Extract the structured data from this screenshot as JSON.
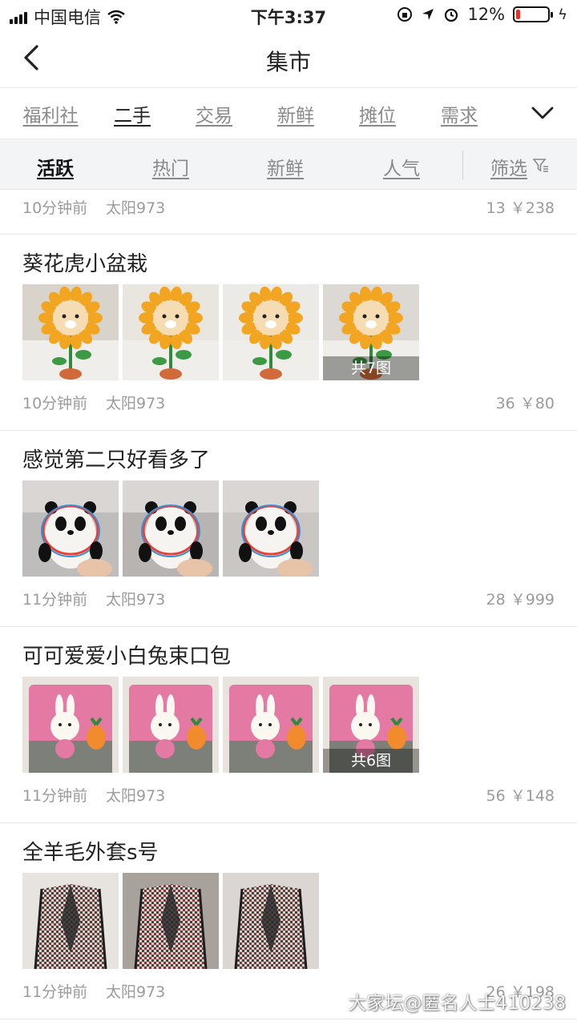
{
  "status_bar": {
    "carrier": "中国电信",
    "time": "下午3:37",
    "battery": "12%",
    "battery_level": 0.12
  },
  "nav": {
    "title": "集市"
  },
  "categories": [
    {
      "label": "福利社",
      "active": false
    },
    {
      "label": "二手",
      "active": true
    },
    {
      "label": "交易",
      "active": false
    },
    {
      "label": "新鲜",
      "active": false
    },
    {
      "label": "摊位",
      "active": false
    },
    {
      "label": "需求",
      "active": false
    }
  ],
  "sort": {
    "options": [
      {
        "label": "活跃",
        "active": true
      },
      {
        "label": "热门",
        "active": false
      },
      {
        "label": "新鲜",
        "active": false
      },
      {
        "label": "人气",
        "active": false
      }
    ],
    "filter_label": "筛选"
  },
  "top_meta": {
    "time": "10分钟前",
    "author": "太阳973",
    "stats": "13 ￥238"
  },
  "posts": [
    {
      "title": "葵花虎小盆栽",
      "time": "10分钟前",
      "author": "太阳973",
      "stats": "36 ￥80",
      "image_count_label": "共7图",
      "thumbs": [
        "sunflower-photo",
        "sunflower-photo",
        "sunflower-photo",
        "sunflower-photo"
      ]
    },
    {
      "title": "感觉第二只好看多了",
      "time": "11分钟前",
      "author": "太阳973",
      "stats": "28 ￥999",
      "image_count_label": "",
      "thumbs": [
        "panda-photo",
        "panda-photo",
        "panda-photo"
      ]
    },
    {
      "title": "可可爱爱小白兔束口包",
      "time": "11分钟前",
      "author": "太阳973",
      "stats": "56 ￥148",
      "image_count_label": "共6图",
      "thumbs": [
        "rabbit-bag-photo",
        "rabbit-bag-photo",
        "rabbit-bag-photo",
        "rabbit-bag-photo"
      ]
    },
    {
      "title": "全羊毛外套s号",
      "time": "11分钟前",
      "author": "太阳973",
      "stats": "26 ￥198",
      "image_count_label": "",
      "thumbs": [
        "coat-photo",
        "coat-photo",
        "coat-photo"
      ]
    }
  ],
  "watermark": "大家坛@匿名人士410238",
  "colors": {
    "accent_text": "#222222",
    "muted_text": "#8a8a8a",
    "sort_bg": "#f3f4f6",
    "battery_low": "#e5332a"
  }
}
